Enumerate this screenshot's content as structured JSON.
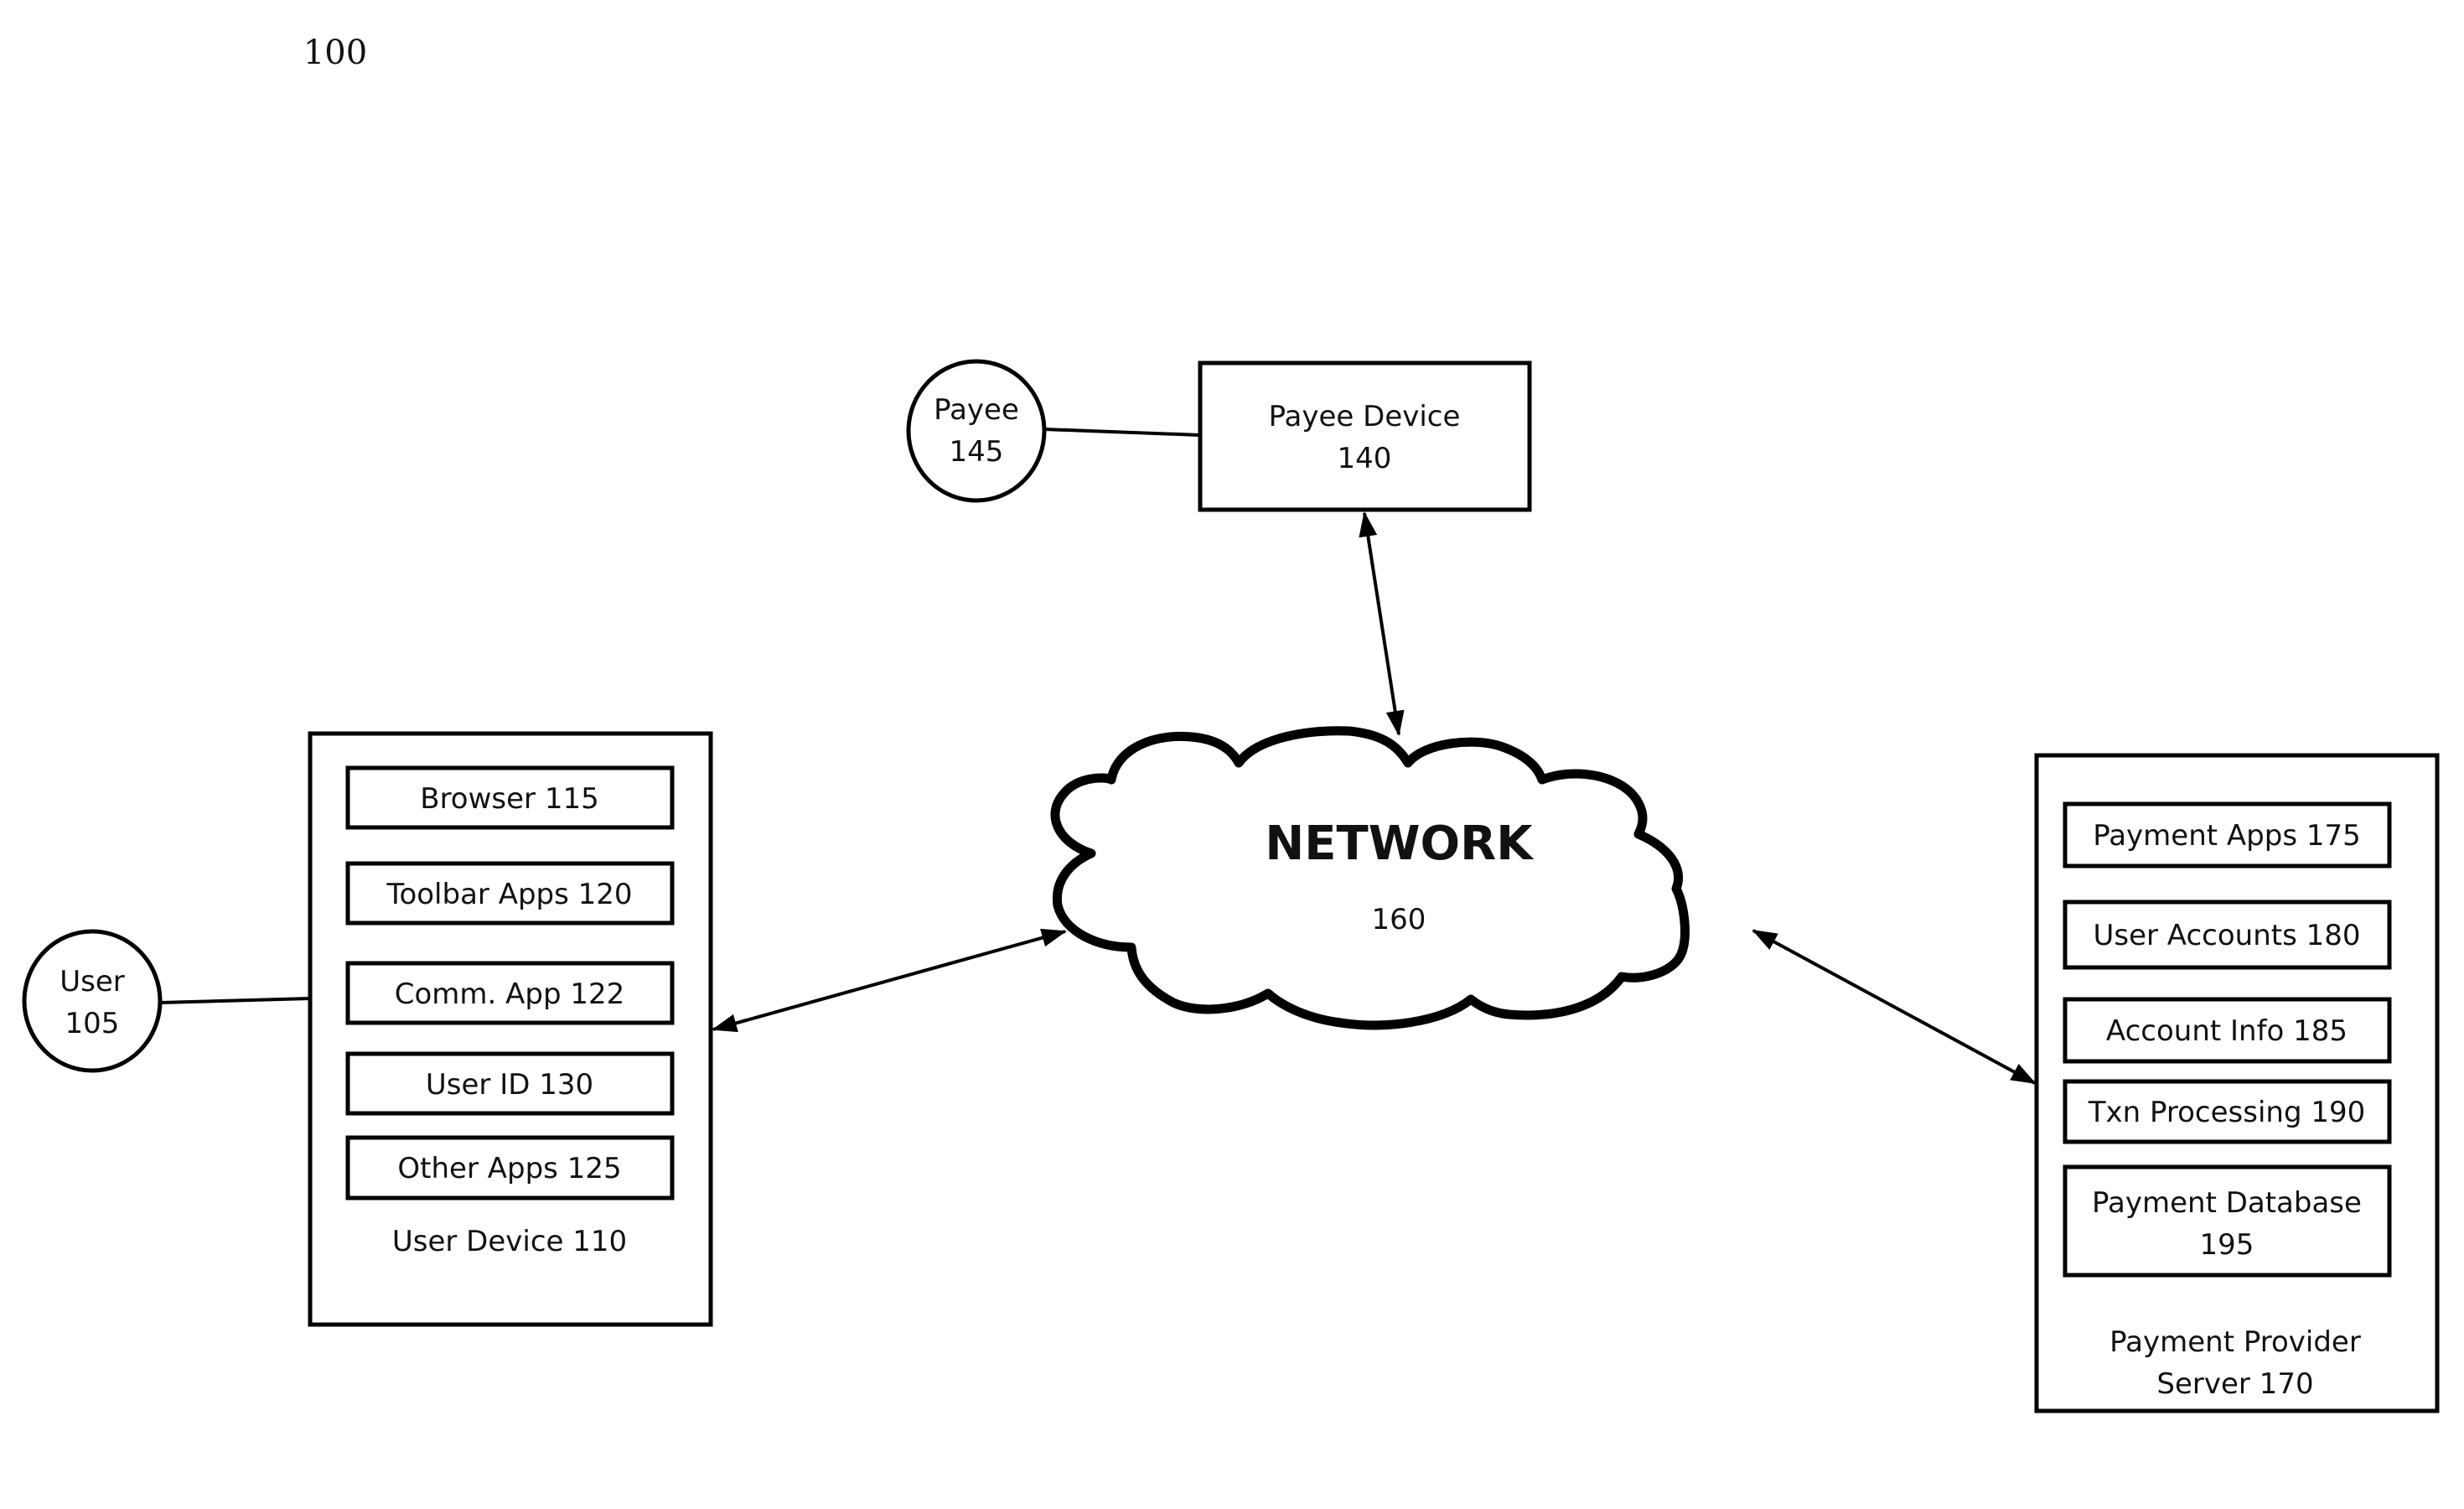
{
  "figure": {
    "reference_number": "100"
  },
  "payee": {
    "name": "Payee",
    "number": "145"
  },
  "payee_device": {
    "name": "Payee Device",
    "number": "140"
  },
  "network": {
    "name": "NETWORK",
    "number": "160"
  },
  "user": {
    "name": "User",
    "number": "105"
  },
  "user_device": {
    "label": "User Device 110",
    "components": [
      {
        "label": "Browser 115"
      },
      {
        "label": "Toolbar Apps 120"
      },
      {
        "label": "Comm. App 122"
      },
      {
        "label": "User ID 130"
      },
      {
        "label": "Other Apps 125"
      }
    ]
  },
  "payment_provider_server": {
    "label_line1": "Payment Provider",
    "label_line2": "Server 170",
    "components": [
      {
        "label": "Payment Apps 175"
      },
      {
        "label": "User Accounts 180"
      },
      {
        "label": "Account Info 185"
      },
      {
        "label": "Txn Processing 190"
      },
      {
        "label_line1": "Payment Database",
        "label_line2": "195"
      }
    ]
  },
  "connections": [
    {
      "from": "payee",
      "to": "payee_device",
      "type": "line"
    },
    {
      "from": "payee_device",
      "to": "network",
      "type": "bidirectional-arrow"
    },
    {
      "from": "user",
      "to": "user_device",
      "type": "line"
    },
    {
      "from": "user_device",
      "to": "network",
      "type": "bidirectional-arrow"
    },
    {
      "from": "network",
      "to": "payment_provider_server",
      "type": "bidirectional-arrow"
    }
  ]
}
